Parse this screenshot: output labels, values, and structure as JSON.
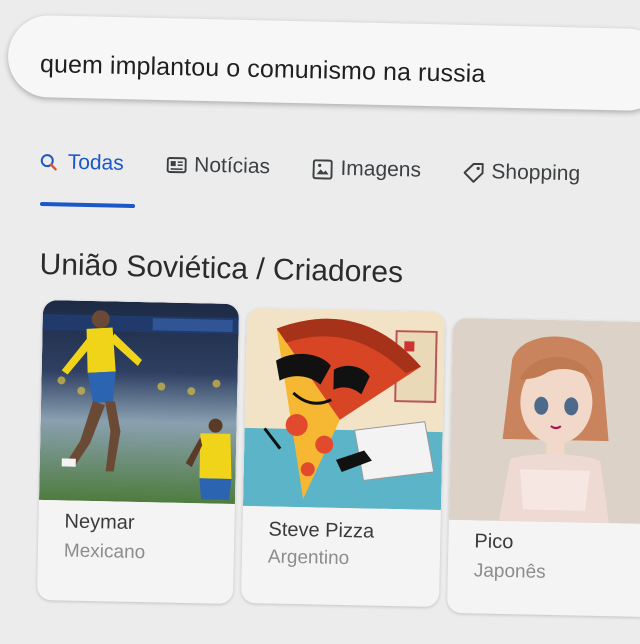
{
  "search": {
    "query": "quem implantou o comunismo na russia"
  },
  "tabs": [
    {
      "label": "Todas",
      "icon": "search-icon",
      "active": true
    },
    {
      "label": "Notícias",
      "icon": "news-icon"
    },
    {
      "label": "Imagens",
      "icon": "image-icon"
    },
    {
      "label": "Shopping",
      "icon": "tag-icon"
    }
  ],
  "panel": {
    "title": "União Soviética / Criadores"
  },
  "cards": [
    {
      "name": "Neymar",
      "subtitle": "Mexicano",
      "image": "soccer-player-photo"
    },
    {
      "name": "Steve Pizza",
      "subtitle": "Argentino",
      "image": "cartoon-pizza-with-sunglasses"
    },
    {
      "name": "Pico",
      "subtitle": "Japonês",
      "image": "anime-girl-drawing"
    }
  ],
  "colors": {
    "accent": "#1a57c9"
  }
}
